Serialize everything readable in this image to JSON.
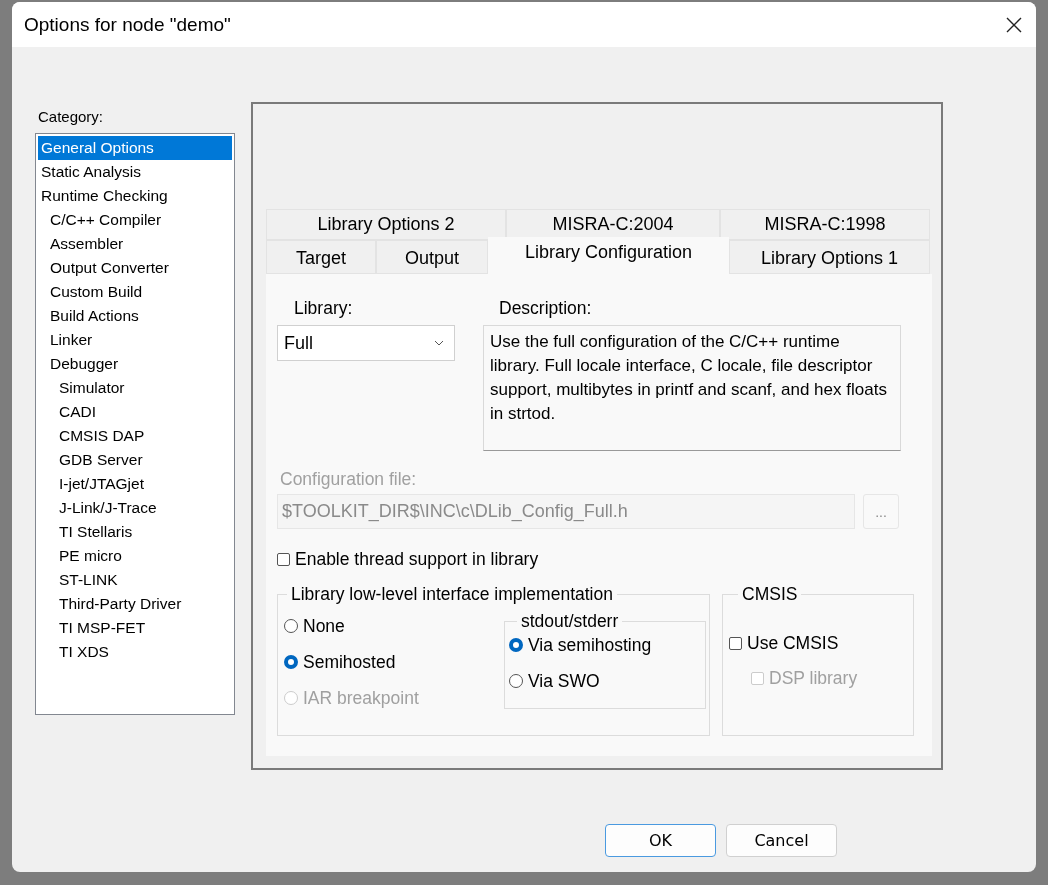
{
  "window": {
    "title": "Options for node \"demo\""
  },
  "category": {
    "label": "Category:",
    "items": [
      {
        "label": "General Options",
        "selected": true
      },
      {
        "label": "Static Analysis",
        "selected": false
      },
      {
        "label": "Runtime Checking",
        "selected": false,
        "children": [
          {
            "label": "C/C++ Compiler",
            "selected": false
          },
          {
            "label": "Assembler",
            "selected": false
          },
          {
            "label": "Output Converter",
            "selected": false
          },
          {
            "label": "Custom Build",
            "selected": false
          },
          {
            "label": "Build Actions",
            "selected": false
          },
          {
            "label": "Linker",
            "selected": false
          },
          {
            "label": "Debugger",
            "selected": false,
            "children": [
              {
                "label": "Simulator",
                "selected": false
              },
              {
                "label": "CADI",
                "selected": false
              },
              {
                "label": "CMSIS DAP",
                "selected": false
              },
              {
                "label": "GDB Server",
                "selected": false
              },
              {
                "label": "I-jet/JTAGjet",
                "selected": false
              },
              {
                "label": "J-Link/J-Trace",
                "selected": false
              },
              {
                "label": "TI Stellaris",
                "selected": false
              },
              {
                "label": "PE micro",
                "selected": false
              },
              {
                "label": "ST-LINK",
                "selected": false
              },
              {
                "label": "Third-Party Driver",
                "selected": false
              },
              {
                "label": "TI MSP-FET",
                "selected": false
              },
              {
                "label": "TI XDS",
                "selected": false
              }
            ]
          }
        ]
      }
    ]
  },
  "tab_rows": [
    [
      {
        "label": "Library Options 2",
        "selected": false
      },
      {
        "label": "MISRA-C:2004",
        "selected": false
      },
      {
        "label": "MISRA-C:1998",
        "selected": false
      }
    ],
    [
      {
        "label": "Target",
        "selected": false
      },
      {
        "label": "Output",
        "selected": false
      },
      {
        "label": "Library Configuration",
        "selected": true
      },
      {
        "label": "Library Options 1",
        "selected": false
      }
    ]
  ],
  "library": {
    "label": "Library:",
    "value": "Full"
  },
  "description": {
    "label": "Description:",
    "text": "Use the full configuration of the C/C++ runtime library. Full locale interface, C locale, file descriptor support, multibytes in printf and scanf, and hex floats in strtod."
  },
  "config_file": {
    "label": "Configuration file:",
    "value": "$TOOLKIT_DIR$\\INC\\c\\DLib_Config_Full.h",
    "disabled": true,
    "browse": "..."
  },
  "thread_support": {
    "label": "Enable thread support in library",
    "checked": false,
    "disabled": false
  },
  "low_level": {
    "title": "Library low-level interface implementation",
    "options": [
      {
        "label": "None",
        "selected": false,
        "disabled": false
      },
      {
        "label": "Semihosted",
        "selected": true,
        "disabled": false
      },
      {
        "label": "IAR breakpoint",
        "selected": false,
        "disabled": true
      }
    ],
    "stdout": {
      "title": "stdout/stderr",
      "options": [
        {
          "label": "Via semihosting",
          "selected": true,
          "disabled": false
        },
        {
          "label": "Via SWO",
          "selected": false,
          "disabled": false
        }
      ]
    }
  },
  "cmsis": {
    "title": "CMSIS",
    "checks": [
      {
        "label": "Use CMSIS",
        "checked": false,
        "disabled": false
      },
      {
        "label": "DSP library",
        "checked": false,
        "disabled": true
      }
    ]
  },
  "buttons": [
    {
      "label": "OK",
      "default": true
    },
    {
      "label": "Cancel",
      "default": false
    }
  ]
}
